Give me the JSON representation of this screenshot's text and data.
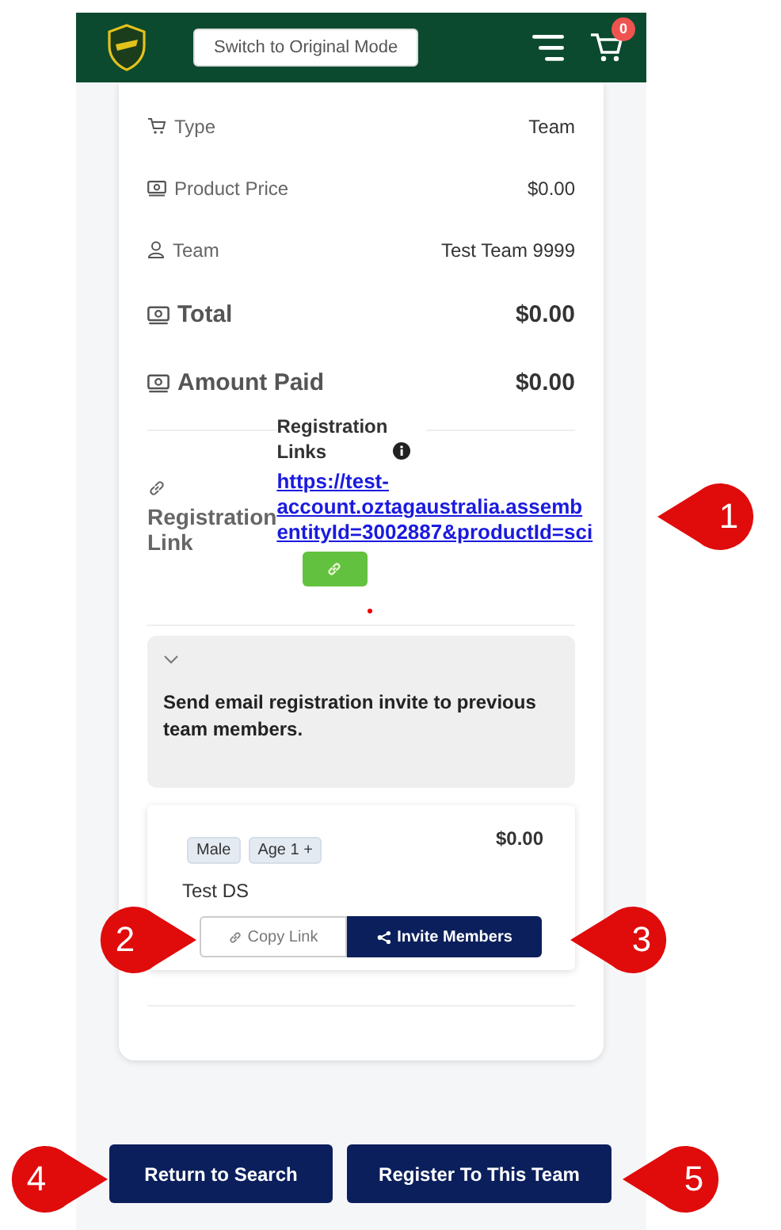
{
  "header": {
    "mode_button": "Switch to Original Mode",
    "cart_count": "0"
  },
  "details": [
    {
      "kind": "cart",
      "label": "Type",
      "value": "Team",
      "emphasis": false
    },
    {
      "kind": "money",
      "label": "Product Price",
      "value": "$0.00",
      "emphasis": false
    },
    {
      "kind": "person",
      "label": "Team",
      "value": "Test Team 9999",
      "emphasis": false
    },
    {
      "kind": "money",
      "label": "Total",
      "value": "$0.00",
      "emphasis": true
    },
    {
      "kind": "money",
      "label": "Amount Paid",
      "value": "$0.00",
      "emphasis": true
    }
  ],
  "registration": {
    "label_lines": [
      "Registration",
      "Link"
    ],
    "heading_lines": [
      "Registration",
      "Links"
    ],
    "link_lines": [
      "https://test-",
      "account.oztagaustralia.assemb",
      "entityId=3002887&productId=sci"
    ]
  },
  "invite_panel": {
    "expanded": false,
    "text": "Send email registration invite to previous team members."
  },
  "member_card": {
    "tags": [
      "Male",
      "Age 1 +"
    ],
    "price": "$0.00",
    "name": "Test DS",
    "copy_button": "Copy Link",
    "invite_button": "Invite Members"
  },
  "footer_buttons": [
    "Return to Search",
    "Register To This Team"
  ],
  "callouts": [
    {
      "label": "1",
      "kind": "right"
    },
    {
      "label": "2",
      "kind": "left"
    },
    {
      "label": "3",
      "kind": "right"
    },
    {
      "label": "4",
      "kind": "left"
    },
    {
      "label": "5",
      "kind": "right"
    }
  ]
}
